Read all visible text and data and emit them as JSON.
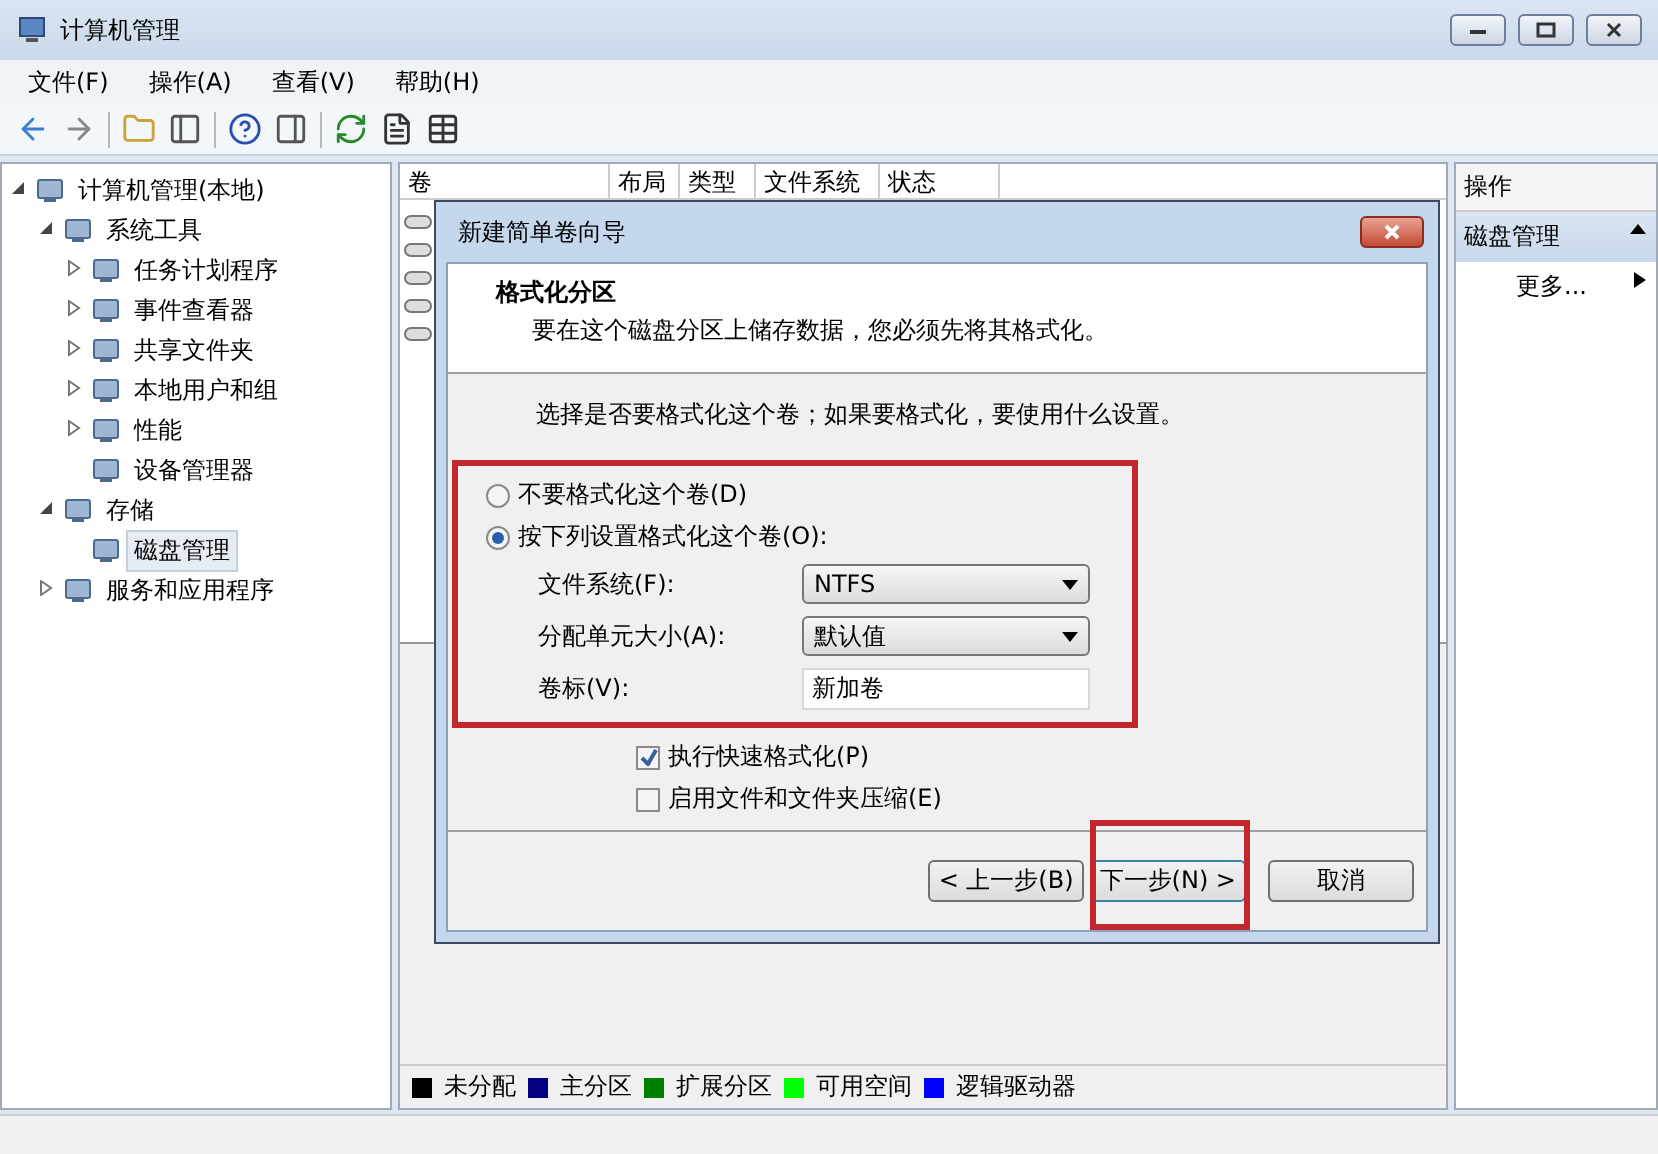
{
  "window": {
    "title": "计算机管理"
  },
  "menu": [
    {
      "label": "文件(F)"
    },
    {
      "label": "操作(A)"
    },
    {
      "label": "查看(V)"
    },
    {
      "label": "帮助(H)"
    }
  ],
  "tree": [
    {
      "label": "计算机管理(本地)",
      "selected": false,
      "expanded": true,
      "children": [
        {
          "label": "系统工具",
          "selected": false,
          "expanded": true,
          "children": [
            {
              "label": "任务计划程序",
              "selected": false,
              "expanded": false
            },
            {
              "label": "事件查看器",
              "selected": false,
              "expanded": false
            },
            {
              "label": "共享文件夹",
              "selected": false,
              "expanded": false
            },
            {
              "label": "本地用户和组",
              "selected": false,
              "expanded": false
            },
            {
              "label": "性能",
              "selected": false,
              "expanded": false
            },
            {
              "label": "设备管理器",
              "selected": false
            }
          ]
        },
        {
          "label": "存储",
          "selected": false,
          "expanded": true,
          "children": [
            {
              "label": "磁盘管理",
              "selected": true
            }
          ]
        },
        {
          "label": "服务和应用程序",
          "selected": false,
          "expanded": false
        }
      ]
    }
  ],
  "table": {
    "columns": [
      "卷",
      "布局",
      "类型",
      "文件系统",
      "状态"
    ]
  },
  "legend": [
    {
      "label": "未分配",
      "color": "#000000"
    },
    {
      "label": "主分区",
      "color": "#000080"
    },
    {
      "label": "扩展分区",
      "color": "#008000"
    },
    {
      "label": "可用空间",
      "color": "#00ff00"
    },
    {
      "label": "逻辑驱动器",
      "color": "#0000ff"
    }
  ],
  "actions": {
    "title": "操作",
    "section": "磁盘管理",
    "items": [
      {
        "label": "更多..."
      }
    ]
  },
  "dialog": {
    "title": "新建简单卷向导",
    "heading": "格式化分区",
    "subtitle": "要在这个磁盘分区上储存数据，您必须先将其格式化。",
    "prompt": "选择是否要格式化这个卷；如果要格式化，要使用什么设置。",
    "options": [
      {
        "label": "不要格式化这个卷(D)",
        "selected": false
      },
      {
        "label": "按下列设置格式化这个卷(O):",
        "selected": true
      }
    ],
    "fields": [
      {
        "kind": "select",
        "label": "文件系统(F):",
        "value": "NTFS"
      },
      {
        "kind": "select",
        "label": "分配单元大小(A):",
        "value": "默认值"
      },
      {
        "kind": "text",
        "label": "卷标(V):",
        "value": "新加卷"
      }
    ],
    "checkboxes": [
      {
        "label": "执行快速格式化(P)",
        "checked": true
      },
      {
        "label": "启用文件和文件夹压缩(E)",
        "checked": false
      }
    ],
    "buttons": [
      {
        "label": "< 上一步(B)",
        "focused": false
      },
      {
        "label": "下一步(N) >",
        "focused": true
      },
      {
        "label": "取消",
        "focused": false
      }
    ]
  }
}
